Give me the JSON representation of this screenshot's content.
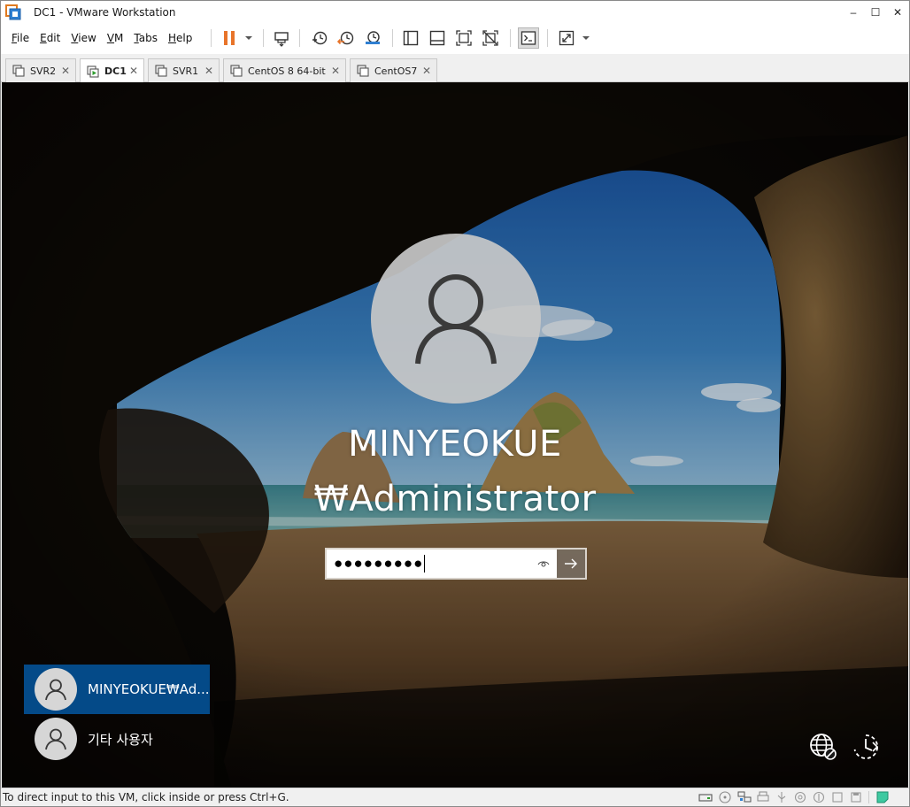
{
  "window": {
    "title": "DC1 - VMware Workstation",
    "minimize": "–",
    "maximize": "☐",
    "close": "✕"
  },
  "menu": [
    {
      "key": "F",
      "rest": "ile"
    },
    {
      "key": "E",
      "rest": "dit"
    },
    {
      "key": "V",
      "rest": "iew"
    },
    {
      "key": "V",
      "rest": "M"
    },
    {
      "key": "T",
      "rest": "abs"
    },
    {
      "key": "H",
      "rest": "elp"
    }
  ],
  "tabs": [
    {
      "label": "SVR2",
      "active": false
    },
    {
      "label": "DC1",
      "active": true
    },
    {
      "label": "SVR1",
      "active": false
    },
    {
      "label": "CentOS 8 64-bit",
      "active": false
    },
    {
      "label": "CentOS7",
      "active": false
    }
  ],
  "tab_close": "✕",
  "login": {
    "username_line1": "MINYEOKUE",
    "username_line2": "₩Administrator",
    "password_mask": "●●●●●●●●●",
    "users": [
      {
        "label": "MINYEOKUE₩Ad...",
        "selected": true
      },
      {
        "label": "기타 사용자",
        "selected": false
      }
    ]
  },
  "colors": {
    "selected_user": "#044a88",
    "pause_icon": "#e8742a"
  },
  "icons": {
    "network": "globe-network-icon",
    "accessibility": "ease-of-access-icon",
    "power": "power-icon"
  },
  "status": {
    "hint": "To direct input to this VM, click inside or press Ctrl+G."
  }
}
